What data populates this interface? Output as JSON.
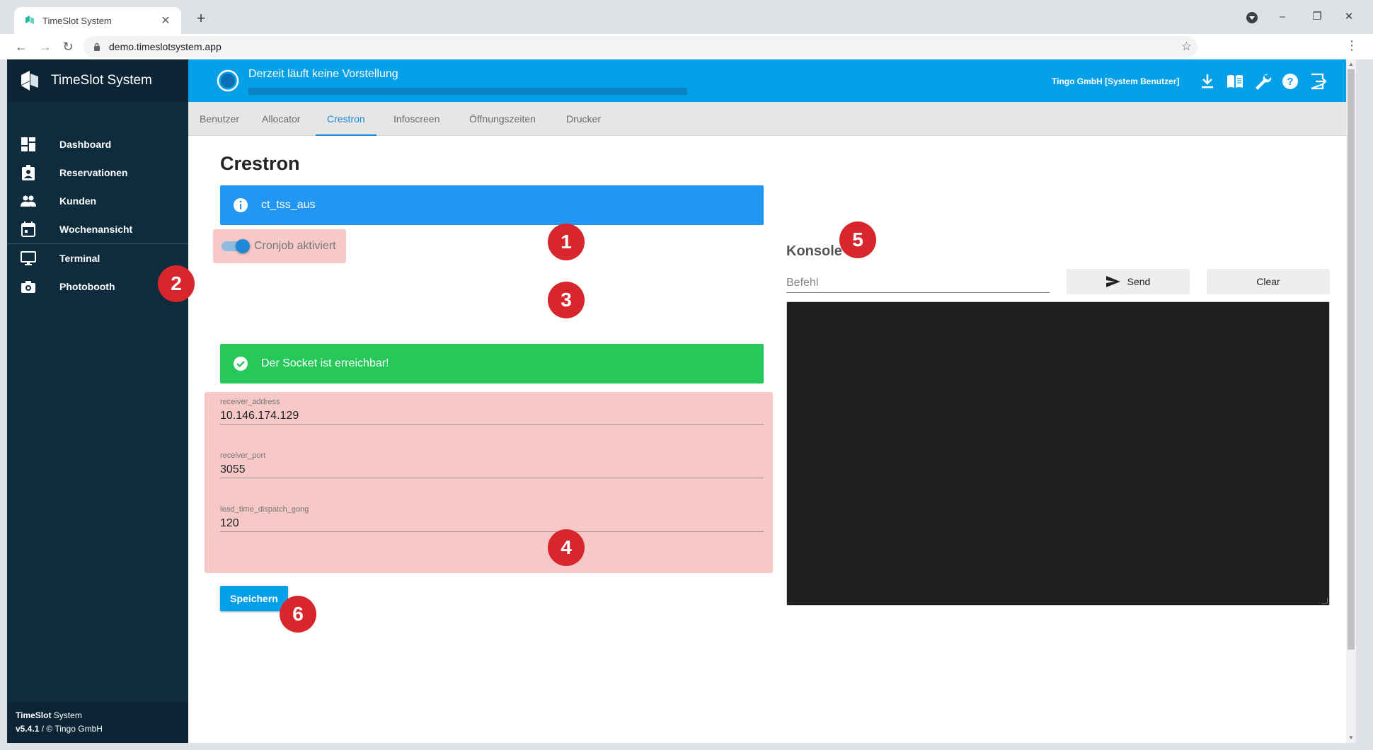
{
  "browser": {
    "tab_title": "TimeSlot System",
    "tab_close": "✕",
    "new_tab": "+",
    "url": "demo.timeslotsystem.app",
    "back": "←",
    "forward": "→",
    "reload": "↻",
    "star": "☆",
    "menu": "⋮",
    "minimize": "–",
    "restore": "❐",
    "close": "✕"
  },
  "sidebar": {
    "brand": "TimeSlot System",
    "items": [
      {
        "label": "Dashboard",
        "icon": "dashboard-icon"
      },
      {
        "label": "Reservationen",
        "icon": "contact-badge-icon"
      },
      {
        "label": "Kunden",
        "icon": "people-icon"
      },
      {
        "label": "Wochenansicht",
        "icon": "calendar-icon"
      },
      {
        "label": "Terminal",
        "icon": "monitor-icon"
      },
      {
        "label": "Photobooth",
        "icon": "camera-icon"
      }
    ],
    "footer_name_bold": "TimeSlot",
    "footer_name_rest": " System",
    "footer_version": "v5.4.1",
    "footer_copyright": " / © Tingo GmbH"
  },
  "topbar": {
    "status_text": "Derzeit läuft keine Vorstellung",
    "user": "Tingo GmbH [System Benutzer]",
    "icons": [
      "download-icon",
      "book-icon",
      "wrench-icon",
      "help-icon",
      "logout-icon"
    ]
  },
  "tabs": [
    {
      "label": "Benutzer",
      "active": false
    },
    {
      "label": "Allocator",
      "active": false
    },
    {
      "label": "Crestron",
      "active": true
    },
    {
      "label": "Infoscreen",
      "active": false
    },
    {
      "label": "Öffnungszeiten",
      "active": false
    },
    {
      "label": "Drucker",
      "active": false
    }
  ],
  "main": {
    "title": "Crestron",
    "info_alert": "ct_tss_aus",
    "cronjob_label": "Cronjob aktiviert",
    "cronjob_enabled": true,
    "success_alert": "Der Socket ist erreichbar!",
    "fields": [
      {
        "label": "receiver_address",
        "value": "10.146.174.129"
      },
      {
        "label": "receiver_port",
        "value": "3055"
      },
      {
        "label": "lead_time_dispatch_gong",
        "value": "120"
      }
    ],
    "save_label": "Speichern"
  },
  "console": {
    "title": "Konsole",
    "command_placeholder": "Befehl",
    "send_label": "Send",
    "clear_label": "Clear"
  },
  "markers": [
    "1",
    "2",
    "3",
    "4",
    "5",
    "6"
  ],
  "colors": {
    "topbar": "#05a0e8",
    "sidebar": "#0f2c3e",
    "info": "#2196f3",
    "success": "#26c85a",
    "highlight": "#f6c8c8",
    "marker": "#d7262c",
    "active_tab": "#1e88d6"
  }
}
